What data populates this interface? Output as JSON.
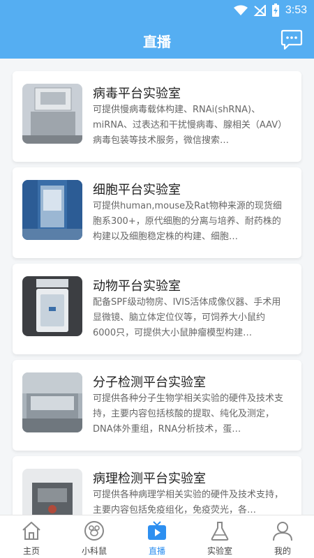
{
  "status": {
    "time": "3:53"
  },
  "header": {
    "title": "直播",
    "chat_icon": "chat-bubble-icon"
  },
  "cards": [
    {
      "title": "病毒平台实验室",
      "desc": "可提供慢病毒载体构建、RNAi(shRNA)、miRNA、过表达和干扰慢病毒、腺相关（AAV）病毒包装等技术服务，微信搜索…"
    },
    {
      "title": "细胞平台实验室",
      "desc": "可提供human,mouse及Rat物种来源的现货细胞系300+，原代细胞的分离与培养、耐药株的构建以及细胞稳定株的构建、细胞…"
    },
    {
      "title": "动物平台实验室",
      "desc": "配备SPF级动物房、IVIS活体成像仪器、手术用显微镜、脑立体定位仪等，可饲养大小鼠约6000只，可提供大小鼠肿瘤模型构建…"
    },
    {
      "title": "分子检测平台实验室",
      "desc": "可提供各种分子生物学相关实验的硬件及技术支持，主要内容包括核酸的提取、纯化及测定，DNA体外重组，RNA分析技术，蛋…"
    },
    {
      "title": "病理检测平台实验室",
      "desc": "可提供各种病理学相关实验的硬件及技术支持，主要内容包括免疫组化，免疫荧光，各…"
    }
  ],
  "tabs": [
    {
      "label": "主页",
      "icon": "home-icon"
    },
    {
      "label": "小科鼠",
      "icon": "mouse-icon"
    },
    {
      "label": "直播",
      "icon": "tv-play-icon"
    },
    {
      "label": "实验室",
      "icon": "flask-icon"
    },
    {
      "label": "我的",
      "icon": "person-icon"
    }
  ],
  "colors": {
    "primary": "#55aef2",
    "active_tab": "#2d8ff0"
  }
}
